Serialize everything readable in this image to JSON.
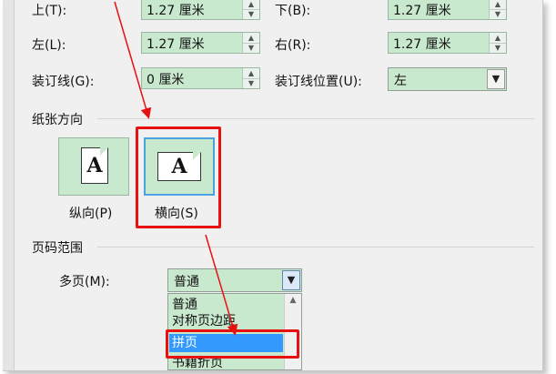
{
  "margins": {
    "top": {
      "label": "上(T):",
      "value": "1.27 厘米"
    },
    "bottom": {
      "label": "下(B):",
      "value": "1.27 厘米"
    },
    "left": {
      "label": "左(L):",
      "value": "1.27 厘米"
    },
    "right": {
      "label": "右(R):",
      "value": "1.27 厘米"
    },
    "gutter": {
      "label": "装订线(G):",
      "value": "0 厘米"
    },
    "gutter_position": {
      "label": "装订线位置(U):",
      "value": "左"
    }
  },
  "orientation": {
    "section_title": "纸张方向",
    "portrait_label": "纵向(P)",
    "landscape_label": "横向(S)",
    "icon_letter": "A",
    "selected": "landscape"
  },
  "page_range": {
    "section_title": "页码范围",
    "multiple_pages_label": "多页(M):",
    "selected_value": "普通",
    "options": [
      "普通",
      "对称页边距",
      "拼页",
      "书籍折页"
    ],
    "highlighted_option": "拼页"
  },
  "colors": {
    "field_bg": "#c9e9cf",
    "highlight": "#3399ff",
    "annotation_red": "#e81010",
    "selection_blue": "#4aa3df"
  }
}
